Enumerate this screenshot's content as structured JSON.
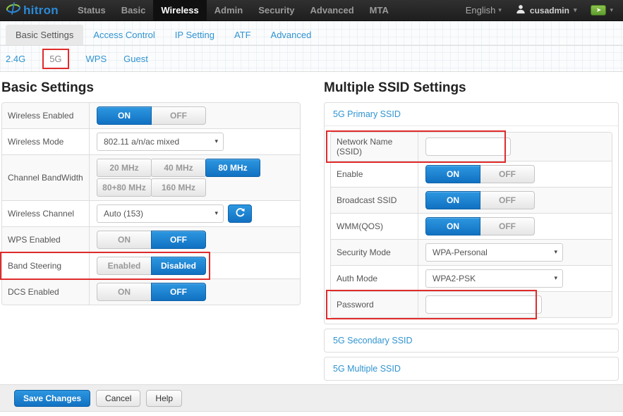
{
  "navbar": {
    "brand": "hitron",
    "items": [
      {
        "label": "Status"
      },
      {
        "label": "Basic"
      },
      {
        "label": "Wireless"
      },
      {
        "label": "Admin"
      },
      {
        "label": "Security"
      },
      {
        "label": "Advanced"
      },
      {
        "label": "MTA"
      }
    ],
    "active_item": "Wireless",
    "language": "English",
    "username": "cusadmin"
  },
  "tabs": {
    "items": [
      {
        "label": "Basic Settings"
      },
      {
        "label": "Access Control"
      },
      {
        "label": "IP Setting"
      },
      {
        "label": "ATF"
      },
      {
        "label": "Advanced"
      }
    ],
    "active": "Basic Settings"
  },
  "subtabs": {
    "items": [
      {
        "label": "2.4G"
      },
      {
        "label": "5G"
      },
      {
        "label": "WPS"
      },
      {
        "label": "Guest"
      }
    ],
    "active": "5G"
  },
  "basic_settings": {
    "title": "Basic Settings",
    "wireless_enabled": {
      "label": "Wireless Enabled",
      "options": [
        "ON",
        "OFF"
      ],
      "value": "ON"
    },
    "wireless_mode": {
      "label": "Wireless Mode",
      "value": "802.11 a/n/ac mixed"
    },
    "channel_bandwidth": {
      "label": "Channel BandWidth",
      "options": [
        "20 MHz",
        "40 MHz",
        "80 MHz",
        "80+80 MHz",
        "160 MHz"
      ],
      "value": "80 MHz"
    },
    "wireless_channel": {
      "label": "Wireless Channel",
      "value": "Auto (153)"
    },
    "wps_enabled": {
      "label": "WPS Enabled",
      "options": [
        "ON",
        "OFF"
      ],
      "value": "OFF"
    },
    "band_steering": {
      "label": "Band Steering",
      "options": [
        "Enabled",
        "Disabled"
      ],
      "value": "Disabled"
    },
    "dcs_enabled": {
      "label": "DCS Enabled",
      "options": [
        "ON",
        "OFF"
      ],
      "value": "OFF"
    }
  },
  "multiple_ssid": {
    "title": "Multiple SSID Settings",
    "primary": {
      "header": "5G Primary SSID",
      "network_name": {
        "label": "Network Name (SSID)",
        "value": ""
      },
      "enable": {
        "label": "Enable",
        "options": [
          "ON",
          "OFF"
        ],
        "value": "ON"
      },
      "broadcast_ssid": {
        "label": "Broadcast SSID",
        "options": [
          "ON",
          "OFF"
        ],
        "value": "ON"
      },
      "wmm_qos": {
        "label": "WMM(QOS)",
        "options": [
          "ON",
          "OFF"
        ],
        "value": "ON"
      },
      "security_mode": {
        "label": "Security Mode",
        "value": "WPA-Personal"
      },
      "auth_mode": {
        "label": "Auth Mode",
        "value": "WPA2-PSK"
      },
      "password": {
        "label": "Password",
        "value": ""
      }
    },
    "secondary": {
      "header": "5G Secondary SSID"
    },
    "multiple": {
      "header": "5G Multiple SSID"
    }
  },
  "footer": {
    "save_label": "Save Changes",
    "cancel_label": "Cancel",
    "help_label": "Help"
  },
  "colors": {
    "accent_blue": "#1171c2",
    "link_blue": "#3094d1",
    "highlight_red": "#e02b2b",
    "navbar_bg": "#262626"
  }
}
